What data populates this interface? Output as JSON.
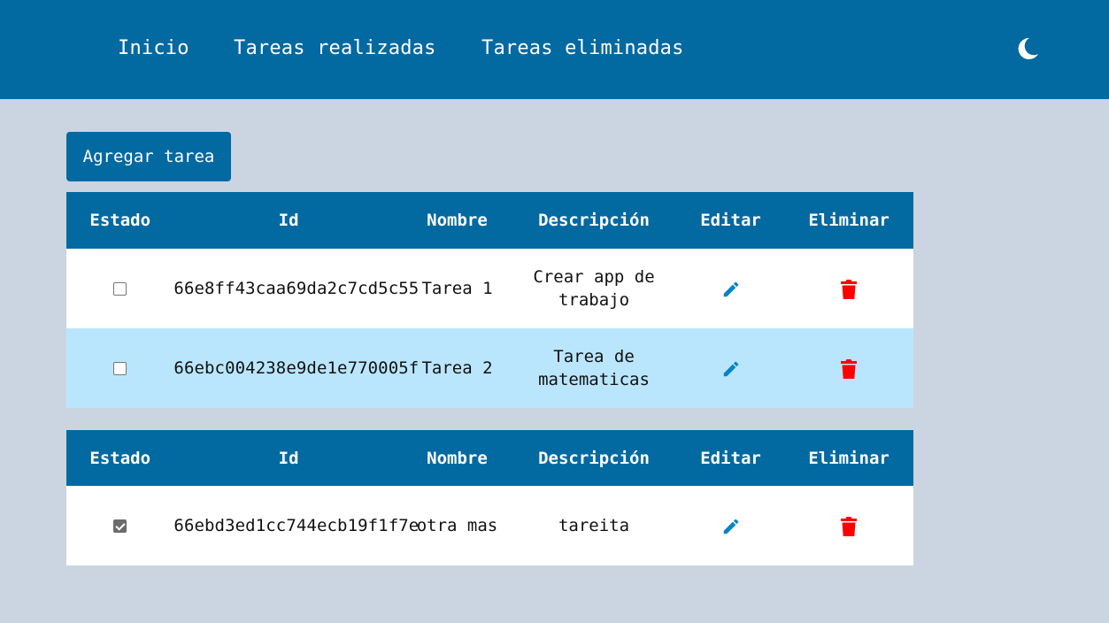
{
  "nav": {
    "links": [
      "Inicio",
      "Tareas realizadas",
      "Tareas eliminadas"
    ],
    "theme_icon": "moon-icon"
  },
  "add_button": "Agregar tarea",
  "headers": [
    "Estado",
    "Id",
    "Nombre",
    "Descripción",
    "Editar",
    "Eliminar"
  ],
  "pending_tasks": [
    {
      "checked": false,
      "id": "66e8ff43caa69da2c7cd5c55",
      "nombre": "Tarea 1",
      "descripcion": "Crear app de trabajo"
    },
    {
      "checked": false,
      "id": "66ebc004238e9de1e770005f",
      "nombre": "Tarea 2",
      "descripcion": "Tarea de matematicas"
    }
  ],
  "done_tasks": [
    {
      "checked": true,
      "id": "66ebd3ed1cc744ecb19f1f7e",
      "nombre": "otra mas",
      "descripcion": "tareita"
    }
  ],
  "colors": {
    "primary": "#0369a1",
    "background": "#cbd5e1",
    "row_alt": "#bae6fd",
    "edit_icon": "#0284c7",
    "delete_icon": "#ff0000"
  }
}
